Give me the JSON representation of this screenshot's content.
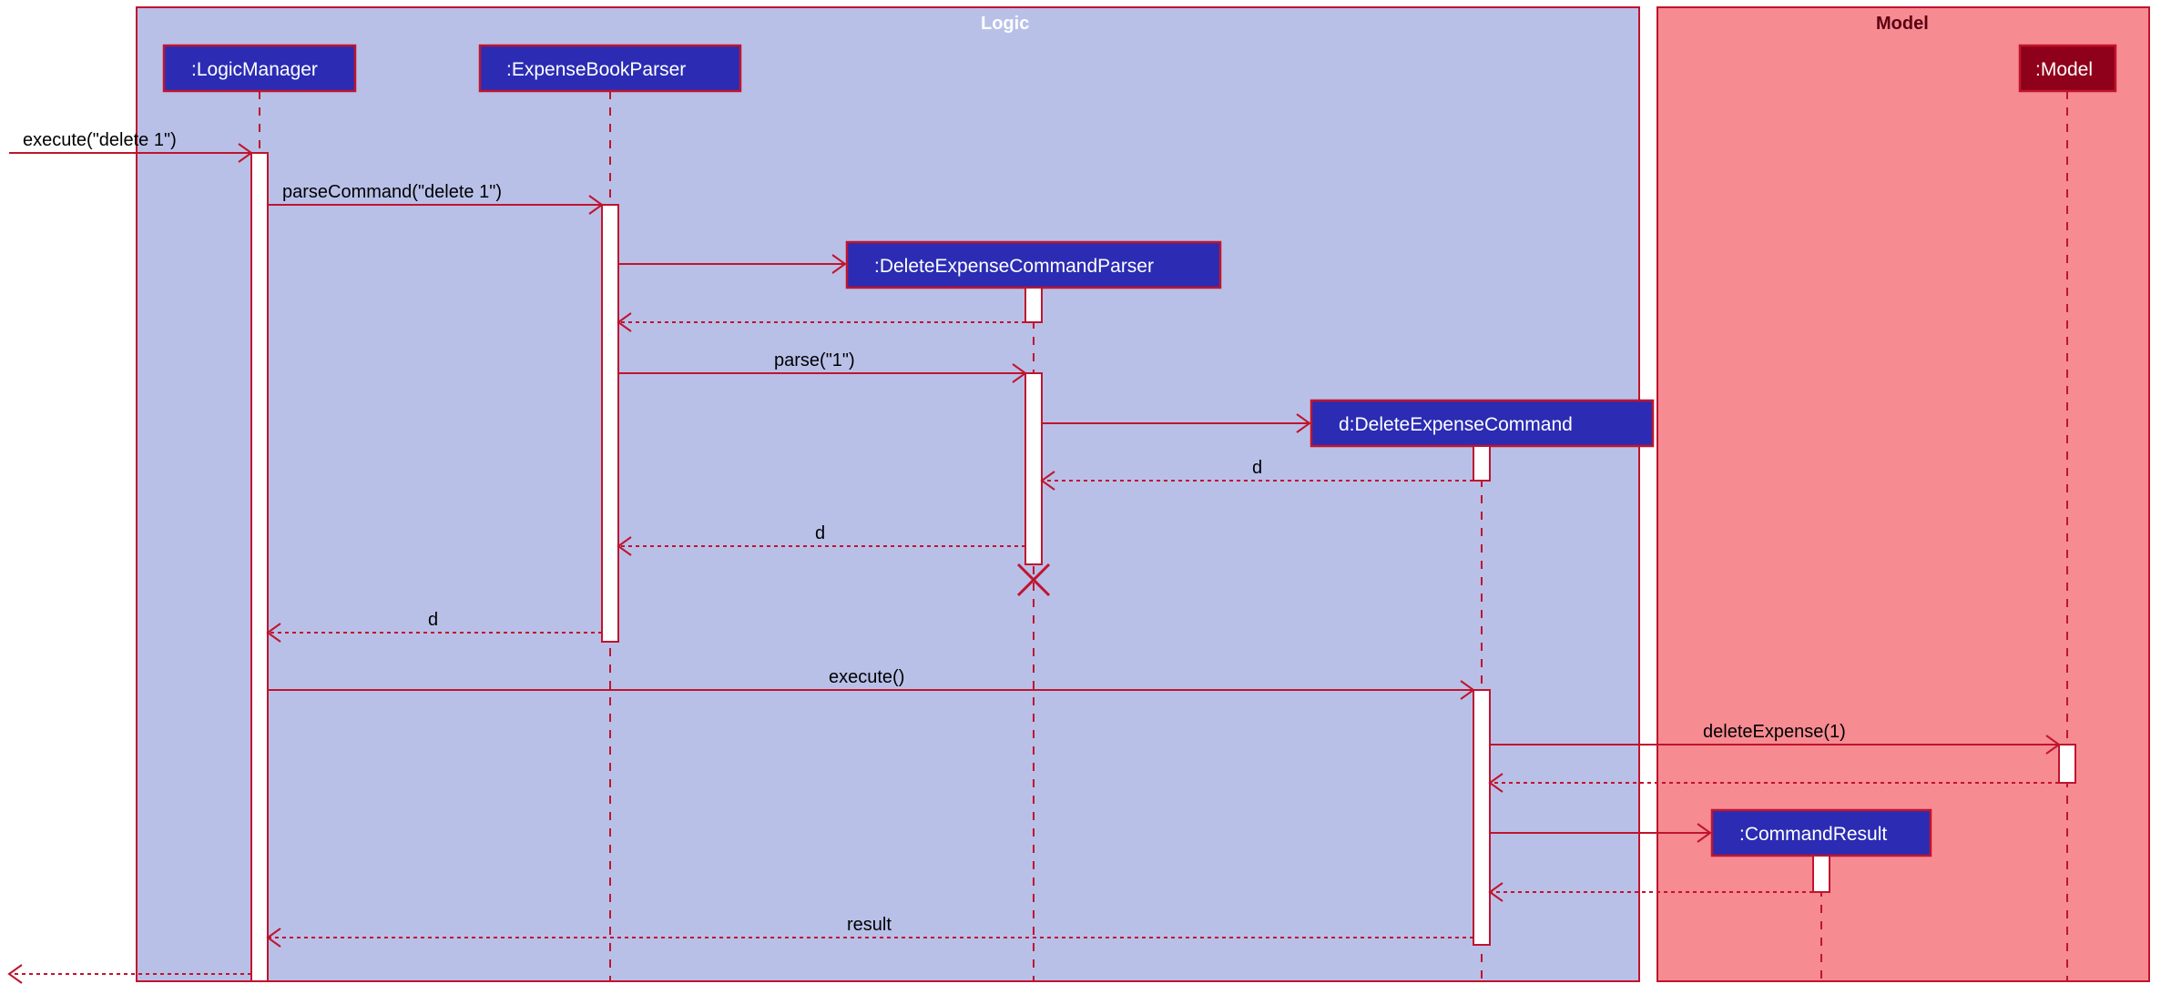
{
  "frames": {
    "logic": "Logic",
    "model": "Model"
  },
  "participants": {
    "logic_manager": ":LogicManager",
    "expense_book_parser": ":ExpenseBookParser",
    "delete_parser": ":DeleteExpenseCommandParser",
    "delete_cmd": "d:DeleteExpenseCommand",
    "command_result": ":CommandResult",
    "model": ":Model"
  },
  "messages": {
    "m1": "execute(\"delete 1\")",
    "m2": "parseCommand(\"delete 1\")",
    "m3": "parse(\"1\")",
    "m4": "d",
    "m5": "d",
    "m6": "d",
    "m7": "execute()",
    "m8": "deleteExpense(1)",
    "m9": "result"
  }
}
